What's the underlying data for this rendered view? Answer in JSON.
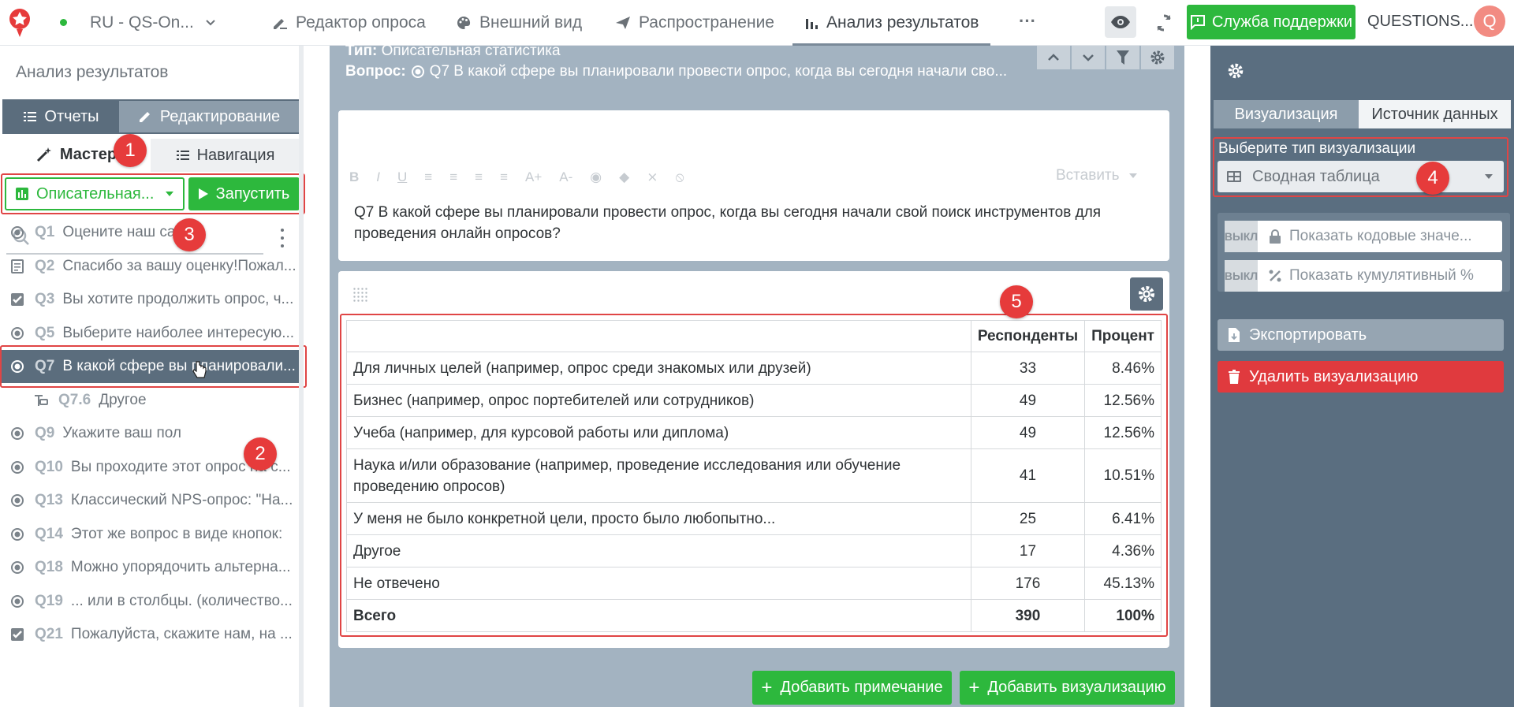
{
  "topbar": {
    "project": "RU - QS-On...",
    "tabs": [
      {
        "label": "Редактор опроса"
      },
      {
        "label": "Внешний вид"
      },
      {
        "label": "Распространение"
      },
      {
        "label": "Анализ результатов"
      }
    ],
    "more": "···",
    "support": "Служба поддержки",
    "account": "QUESTIONS...",
    "avatar": "Q"
  },
  "left": {
    "title": "Анализ результатов",
    "reports": "Отчеты",
    "editing": "Редактирование",
    "master": "Мастер",
    "navigation": "Навигация",
    "analysis_select": "Описательная...",
    "run": "Запустить",
    "questions": [
      {
        "id": "Q1",
        "text": "Оцените наш сайт",
        "icon": "radio-icon"
      },
      {
        "id": "Q2",
        "text": "Спасибо за вашу оценку!Пожал...",
        "icon": "text-icon"
      },
      {
        "id": "Q3",
        "text": "Вы хотите продолжить опрос, ч...",
        "icon": "checkbox-icon"
      },
      {
        "id": "Q5",
        "text": "Выберите наиболее интересую...",
        "icon": "radio-icon"
      },
      {
        "id": "Q7",
        "text": "В какой сфере вы планировали...",
        "icon": "radio-icon",
        "selected": true
      },
      {
        "id": "Q7.6",
        "text": "Другое",
        "icon": "sub-icon",
        "sub": true
      },
      {
        "id": "Q9",
        "text": "Укажите ваш пол",
        "icon": "radio-icon"
      },
      {
        "id": "Q10",
        "text": "Вы проходите этот опрос на с...",
        "icon": "radio-icon"
      },
      {
        "id": "Q13",
        "text": "Классический NPS-опрос: \"На...",
        "icon": "radio-icon"
      },
      {
        "id": "Q14",
        "text": "Этот же вопрос в виде кнопок:",
        "icon": "radio-icon"
      },
      {
        "id": "Q18",
        "text": "Можно упорядочить альтерна...",
        "icon": "radio-icon"
      },
      {
        "id": "Q19",
        "text": "... или в столбцы. (количество...",
        "icon": "radio-icon"
      },
      {
        "id": "Q21",
        "text": "Пожалуйста, скажите нам, на ...",
        "icon": "checkbox-icon"
      }
    ]
  },
  "header": {
    "type_label": "Тип:",
    "type_value": "Описательная статистика",
    "question_label": "Вопрос:",
    "question_value": "Q7 В какой сфере вы планировали провести опрос, когда вы сегодня начали сво..."
  },
  "editor": {
    "toolbar": [
      "B",
      "I",
      "U",
      "≡",
      "≡",
      "≡",
      "≡",
      "A+",
      "A-",
      "◉",
      "◆",
      "⨯",
      "⦸"
    ],
    "insert": "Вставить",
    "text": "Q7 В какой сфере вы планировали провести опрос, когда вы сегодня начали свой поиск инструментов для проведения онлайн опросов?"
  },
  "table": {
    "headers": [
      "",
      "Респонденты",
      "Процент"
    ],
    "rows": [
      {
        "label": "Для личных целей (например, опрос среди знакомых или друзей)",
        "count": "33",
        "pct": "8.46%"
      },
      {
        "label": "Бизнес (например, опрос портебителей или сотрудников)",
        "count": "49",
        "pct": "12.56%"
      },
      {
        "label": "Учеба (например, для курсовой работы или диплома)",
        "count": "49",
        "pct": "12.56%"
      },
      {
        "label": "Наука и/или образование (например, проведение исследования или обучение проведению опросов)",
        "count": "41",
        "pct": "10.51%"
      },
      {
        "label": "У меня не было конкретной цели, просто было любопытно...",
        "count": "25",
        "pct": "6.41%"
      },
      {
        "label": "Другое",
        "count": "17",
        "pct": "4.36%"
      },
      {
        "label": "Не отвечено",
        "count": "176",
        "pct": "45.13%"
      }
    ],
    "total": {
      "label": "Всего",
      "count": "390",
      "pct": "100%"
    }
  },
  "actions": {
    "add_note": "Добавить примечание",
    "add_vis": "Добавить визуализацию"
  },
  "right": {
    "tab_vis": "Визуализация",
    "tab_source": "Источник данных",
    "choose_label": "Выберите тип визуализации",
    "vis_type": "Сводная таблица",
    "toggle1_state": "ВЫКЛ",
    "toggle1_label": "Показать кодовые значе...",
    "toggle2_state": "ВЫКЛ",
    "toggle2_label": "Показать кумулятивный %",
    "export": "Экспортировать",
    "delete": "Удалить визуализацию"
  },
  "badges": [
    "1",
    "2",
    "3",
    "4",
    "5"
  ],
  "colors": {
    "accent_green": "#2db83d",
    "danger": "#e03a3e",
    "highlight": "#e04545"
  }
}
